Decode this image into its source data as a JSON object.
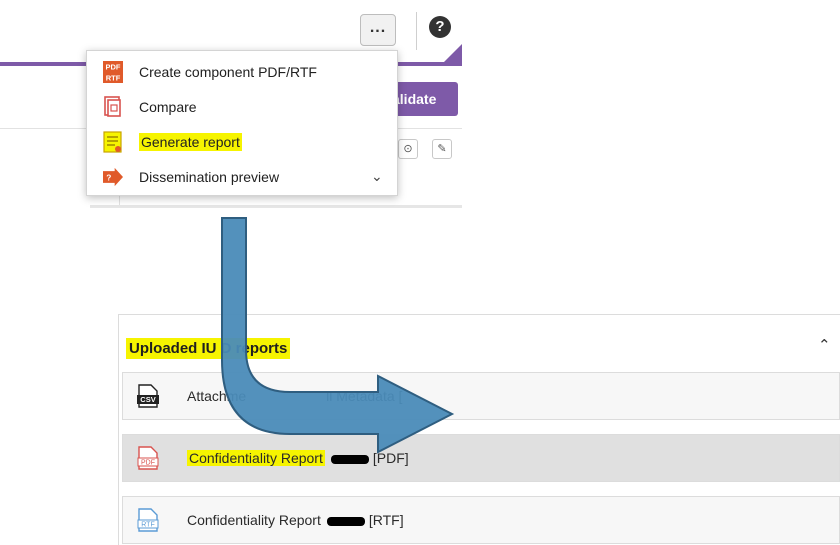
{
  "toolbar": {
    "more_label": "...",
    "help_label": "?",
    "validate_label": "alidate"
  },
  "menu": {
    "items": [
      {
        "label": "Create component PDF/RTF",
        "icon": "pdf-rtf-icon",
        "highlighted": false
      },
      {
        "label": "Compare",
        "icon": "compare-icon",
        "highlighted": false
      },
      {
        "label": "Generate report",
        "icon": "report-icon",
        "highlighted": true
      },
      {
        "label": "Dissemination preview",
        "icon": "dissemination-icon",
        "highlighted": false
      }
    ],
    "pdf_icon_text": "PDF",
    "rtf_icon_text": "RTF"
  },
  "reports": {
    "title": "Uploaded IU     D reports",
    "rows": [
      {
        "label_start": "Attachme",
        "label_end": "ll Metadata  [",
        "icon": "csv-icon",
        "icon_text": "CSV"
      },
      {
        "label": "Confidentiality Report",
        "suffix": "[PDF]",
        "icon": "pdf-file-icon",
        "icon_text": "PDF",
        "selected": true
      },
      {
        "label": "Confidentiality Report",
        "suffix": "[RTF]",
        "icon": "rtf-file-icon",
        "icon_text": "RTF",
        "selected": false
      }
    ]
  },
  "colors": {
    "accent": "#7e5aa8",
    "highlight": "#f6f400",
    "arrow_fill": "#4a8bb8",
    "arrow_stroke": "#2f5e80"
  }
}
